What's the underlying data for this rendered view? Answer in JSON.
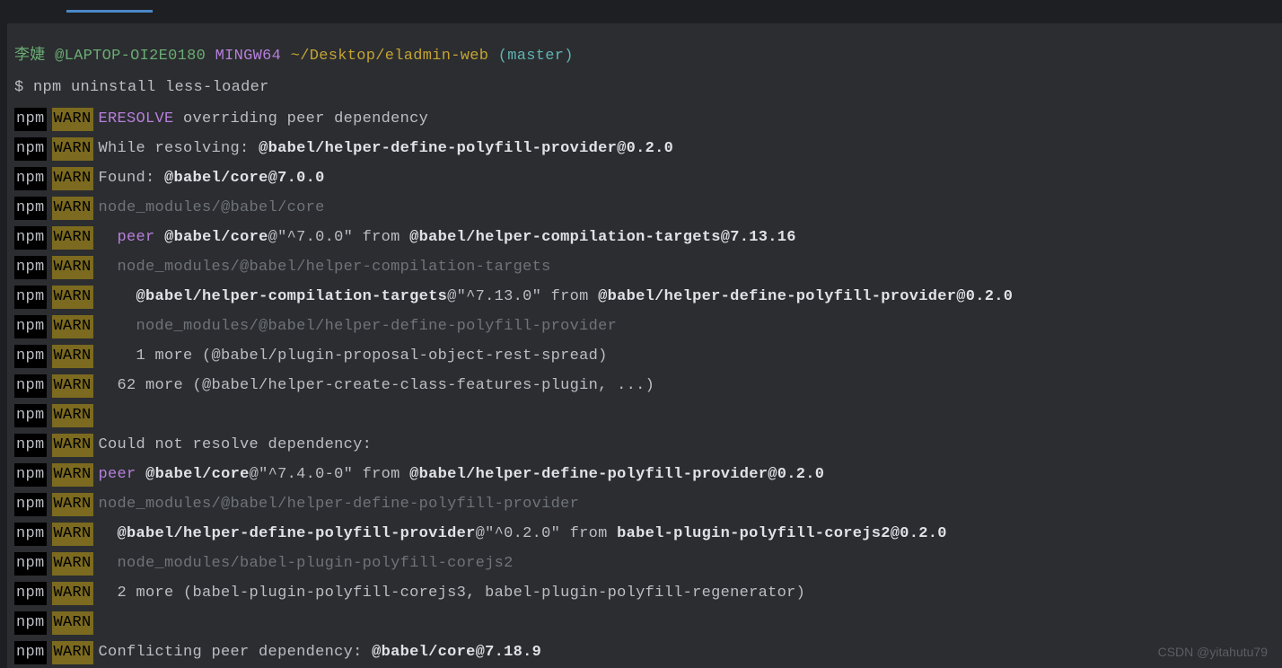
{
  "prompt": {
    "user": "李婕",
    "at_host": "@LAPTOP-OI2E0180",
    "shell": "MINGW64",
    "path": "~/Desktop/eladmin-web",
    "branch": "(master)"
  },
  "command": {
    "dollar": "$",
    "text": "npm uninstall less-loader"
  },
  "tags": {
    "npm": "npm",
    "warn": "WARN"
  },
  "warns": [
    {
      "type": "eresolve",
      "code": "ERESOLVE",
      "rest": " overriding peer dependency"
    },
    {
      "type": "plain",
      "pre": "While resolving: ",
      "bold": "@babel/helper-define-polyfill-provider@0.2.0"
    },
    {
      "type": "plain",
      "pre": "Found: ",
      "bold": "@babel/core@7.0.0"
    },
    {
      "type": "dim",
      "text": "node_modules/@babel/core"
    },
    {
      "type": "peer",
      "indent": "  ",
      "kw": "peer",
      "a": "@babel/core",
      "v": "@\"^7.0.0\"",
      "from": " from ",
      "b": "@babel/helper-compilation-targets@7.13.16"
    },
    {
      "type": "dim",
      "text": "  node_modules/@babel/helper-compilation-targets"
    },
    {
      "type": "inner",
      "indent": "    ",
      "a": "@babel/helper-compilation-targets",
      "v": "@\"^7.13.0\"",
      "from": " from ",
      "b": "@babel/helper-define-polyfill-provider@0.2.0"
    },
    {
      "type": "dim",
      "text": "    node_modules/@babel/helper-define-polyfill-provider"
    },
    {
      "type": "plain2",
      "text": "    1 more (@babel/plugin-proposal-object-rest-spread)"
    },
    {
      "type": "plain2",
      "text": "  62 more (@babel/helper-create-class-features-plugin, ...)"
    },
    {
      "type": "empty"
    },
    {
      "type": "plain2",
      "text": "Could not resolve dependency:"
    },
    {
      "type": "peer",
      "indent": "",
      "kw": "peer",
      "a": "@babel/core",
      "v": "@\"^7.4.0-0\"",
      "from": " from ",
      "b": "@babel/helper-define-polyfill-provider@0.2.0"
    },
    {
      "type": "dim",
      "text": "node_modules/@babel/helper-define-polyfill-provider"
    },
    {
      "type": "inner",
      "indent": "  ",
      "a": "@babel/helper-define-polyfill-provider",
      "v": "@\"^0.2.0\"",
      "from": " from ",
      "b": "babel-plugin-polyfill-corejs2@0.2.0"
    },
    {
      "type": "dim",
      "text": "  node_modules/babel-plugin-polyfill-corejs2"
    },
    {
      "type": "plain2",
      "text": "  2 more (babel-plugin-polyfill-corejs3, babel-plugin-polyfill-regenerator)"
    },
    {
      "type": "empty"
    },
    {
      "type": "plain",
      "pre": "Conflicting peer dependency: ",
      "bold": "@babel/core@7.18.9"
    }
  ],
  "watermark": "CSDN @yitahutu79"
}
